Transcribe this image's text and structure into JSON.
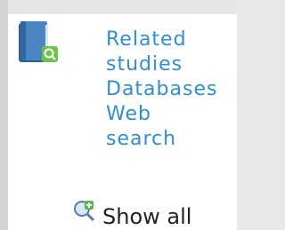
{
  "panel": {
    "icon": "book-magnifier-icon",
    "links": [
      {
        "label": "Related"
      },
      {
        "label": "studies"
      },
      {
        "label": "Databases"
      },
      {
        "label": "Web"
      },
      {
        "label": "search"
      }
    ]
  },
  "footer": {
    "icon": "add-search-icon",
    "show_all_label": "Show all"
  },
  "colors": {
    "link": "#2f8fd0",
    "panel_bg": "#ffffff",
    "page_bg": "#e8e8e8",
    "book": "#3a6fa8",
    "badge": "#6cc24a"
  }
}
